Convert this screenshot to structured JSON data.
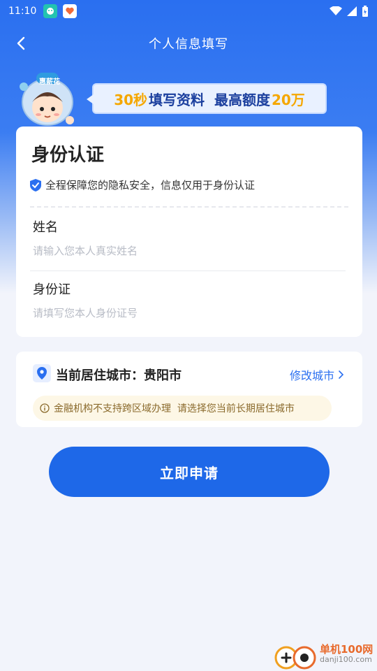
{
  "status_bar": {
    "time": "11:10"
  },
  "nav": {
    "title": "个人信息填写"
  },
  "promo": {
    "mascot_badge": "惠薪花",
    "part1": "30秒",
    "part2": "填写资料  最高额度",
    "part3": "20万"
  },
  "identity": {
    "title": "身份认证",
    "privacy_notice": "全程保障您的隐私安全，信息仅用于身份认证",
    "name_label": "姓名",
    "name_placeholder": "请输入您本人真实姓名",
    "id_label": "身份证",
    "id_placeholder": "请填写您本人身份证号"
  },
  "city": {
    "label": "当前居住城市：贵阳市",
    "change_label": "修改城市",
    "notice": "金融机构不支持跨区域办理  请选择您当前长期居住城市"
  },
  "apply_button": {
    "label": "立即申请"
  },
  "watermark": {
    "main": "单机100网",
    "url": "danji100.com"
  },
  "colors": {
    "primary": "#1e68e8",
    "header_gradient_top": "#2a6ff0",
    "page_bg": "#f2f4fb",
    "promo_highlight": "#f5a700",
    "notice_bg": "#fdf7e6"
  }
}
